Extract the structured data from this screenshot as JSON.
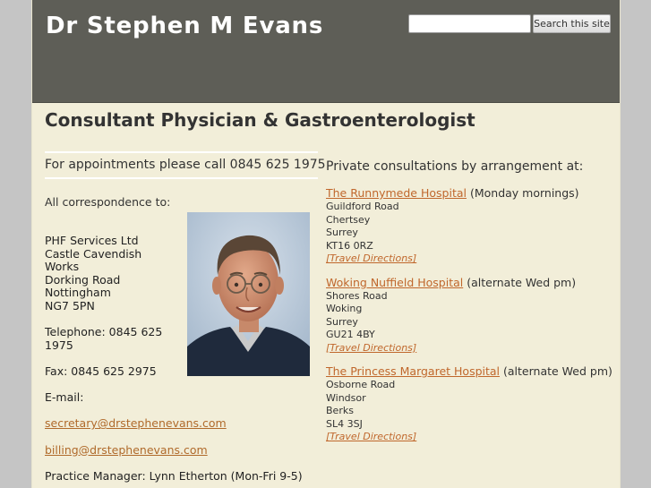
{
  "header": {
    "site_title": "Dr Stephen M Evans",
    "search": {
      "placeholder": "",
      "button_label": "Search this site"
    }
  },
  "main": {
    "page_title": "Consultant Physician & Gastroenterologist",
    "appointments": "For appointments please call 0845 625 1975",
    "correspondence_label": "All correspondence to:",
    "address_lines": [
      "PHF Services Ltd",
      "Castle Cavendish Works",
      "Dorking Road",
      "Nottingham",
      "NG7 5PN"
    ],
    "telephone": "Telephone: 0845 625 1975",
    "fax": "Fax: 0845 625 2975",
    "email_label": "E-mail:",
    "email_secretary": "secretary@drstephenevans.com",
    "email_billing": "billing@drstephenevans.com",
    "practice_manager": "Practice Manager: Lynn Etherton (Mon-Fri 9-5)"
  },
  "private": {
    "heading": "Private consultations by arrangement at:",
    "hospitals": [
      {
        "name": "The Runnymede Hospital",
        "schedule": "(Monday mornings)",
        "address": [
          "Guildford Road",
          "Chertsey",
          "Surrey",
          "KT16 0RZ"
        ],
        "directions": "[Travel Directions]"
      },
      {
        "name": "Woking Nuffield Hospital",
        "schedule": "(alternate Wed pm)",
        "address": [
          "Shores Road",
          "Woking",
          "Surrey",
          "GU21 4BY"
        ],
        "directions": "[Travel Directions]"
      },
      {
        "name": "The Princess Margaret Hospital",
        "schedule": "(alternate Wed pm)",
        "address": [
          "Osborne Road",
          "Windsor",
          "Berks",
          "SL4 3SJ"
        ],
        "directions": "[Travel Directions]"
      }
    ]
  },
  "colors": {
    "header_bg": "#5e5e57",
    "content_bg": "#f2eed9",
    "outer_bg": "#c5c5c5",
    "link": "#c0672c"
  }
}
